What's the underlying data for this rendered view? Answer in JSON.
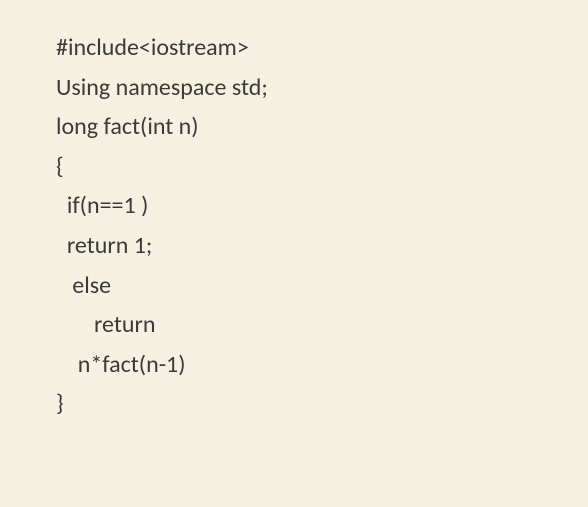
{
  "code": {
    "lines": [
      "#include<iostream>",
      "Using namespace std;",
      "long fact(int n)",
      "{",
      "  if(n==1 )",
      "  return 1;",
      "   else",
      "       return",
      "    n*fact(n-1)",
      "}"
    ]
  }
}
